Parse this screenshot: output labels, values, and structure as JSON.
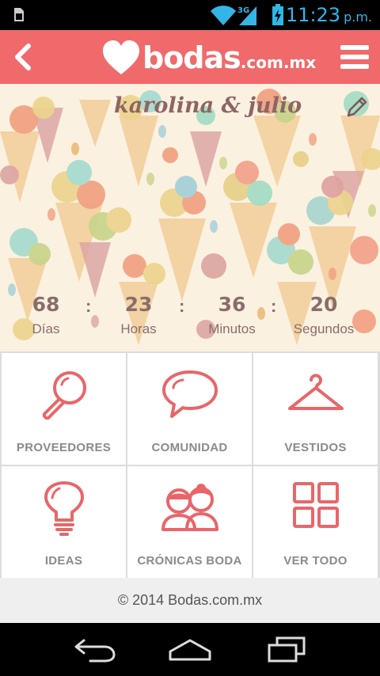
{
  "status_bar": {
    "time": "11:23",
    "ampm": "p.m.",
    "network": "3G",
    "accent_color": "#33b5e5"
  },
  "app_bar": {
    "brand": "bodas",
    "brand_suffix": ".com.mx",
    "color": "#f06a6c"
  },
  "hero": {
    "couple_name": "karolina & julio",
    "countdown": [
      {
        "value": "68",
        "label": "Días"
      },
      {
        "value": "23",
        "label": "Horas"
      },
      {
        "value": "36",
        "label": "Minutos"
      },
      {
        "value": "20",
        "label": "Segundos"
      }
    ],
    "separator": ":"
  },
  "grid": {
    "tiles": [
      {
        "label": "PROVEEDORES",
        "icon": "magnifier-icon"
      },
      {
        "label": "COMUNIDAD",
        "icon": "speech-bubble-icon"
      },
      {
        "label": "VESTIDOS",
        "icon": "hanger-icon"
      },
      {
        "label": "IDEAS",
        "icon": "lightbulb-icon"
      },
      {
        "label": "CRÓNICAS BODA",
        "icon": "couple-icon"
      },
      {
        "label": "VER TODO",
        "icon": "grid-icon"
      }
    ],
    "icon_color": "#e8666a"
  },
  "footer": {
    "text": "© 2014 Bodas.com.mx"
  },
  "nav_bar": {
    "buttons": [
      "back-nav-icon",
      "home-nav-icon",
      "recents-nav-icon"
    ]
  }
}
